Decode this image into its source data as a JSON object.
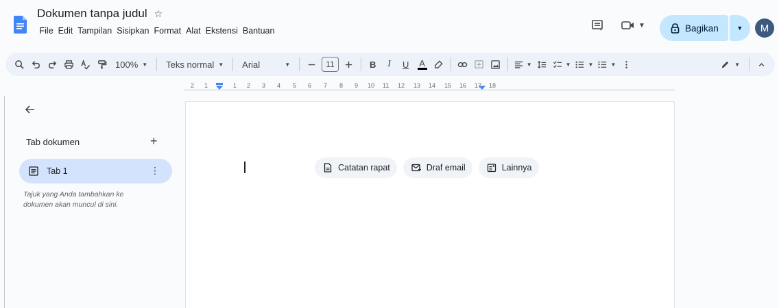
{
  "header": {
    "title": "Dokumen tanpa judul",
    "menu": [
      "File",
      "Edit",
      "Tampilan",
      "Sisipkan",
      "Format",
      "Alat",
      "Ekstensi",
      "Bantuan"
    ],
    "share_label": "Bagikan",
    "avatar_initial": "M"
  },
  "toolbar": {
    "zoom": "100%",
    "style": "Teks normal",
    "font": "Arial",
    "font_size": "11",
    "bold": "B",
    "italic": "I",
    "underline": "U",
    "text_color": "A"
  },
  "ruler": {
    "labels": [
      "2",
      "1",
      "1",
      "2",
      "3",
      "4",
      "5",
      "6",
      "7",
      "8",
      "9",
      "10",
      "11",
      "12",
      "13",
      "14",
      "15",
      "16",
      "17",
      "18"
    ]
  },
  "sidebar": {
    "header": "Tab dokumen",
    "tabs": [
      {
        "label": "Tab 1"
      }
    ],
    "hint": "Tajuk yang Anda tambahkan ke dokumen akan muncul di sini."
  },
  "chips": [
    {
      "label": "Catatan rapat",
      "icon": "document-icon"
    },
    {
      "label": "Draf email",
      "icon": "email-draft-icon"
    },
    {
      "label": "Lainnya",
      "icon": "more-templates-icon"
    }
  ],
  "colors": {
    "accent": "#c2e7ff",
    "active_tab": "#d3e3fd",
    "toolbar_bg": "#edf2fa",
    "doc_icon": "#4285f4"
  }
}
